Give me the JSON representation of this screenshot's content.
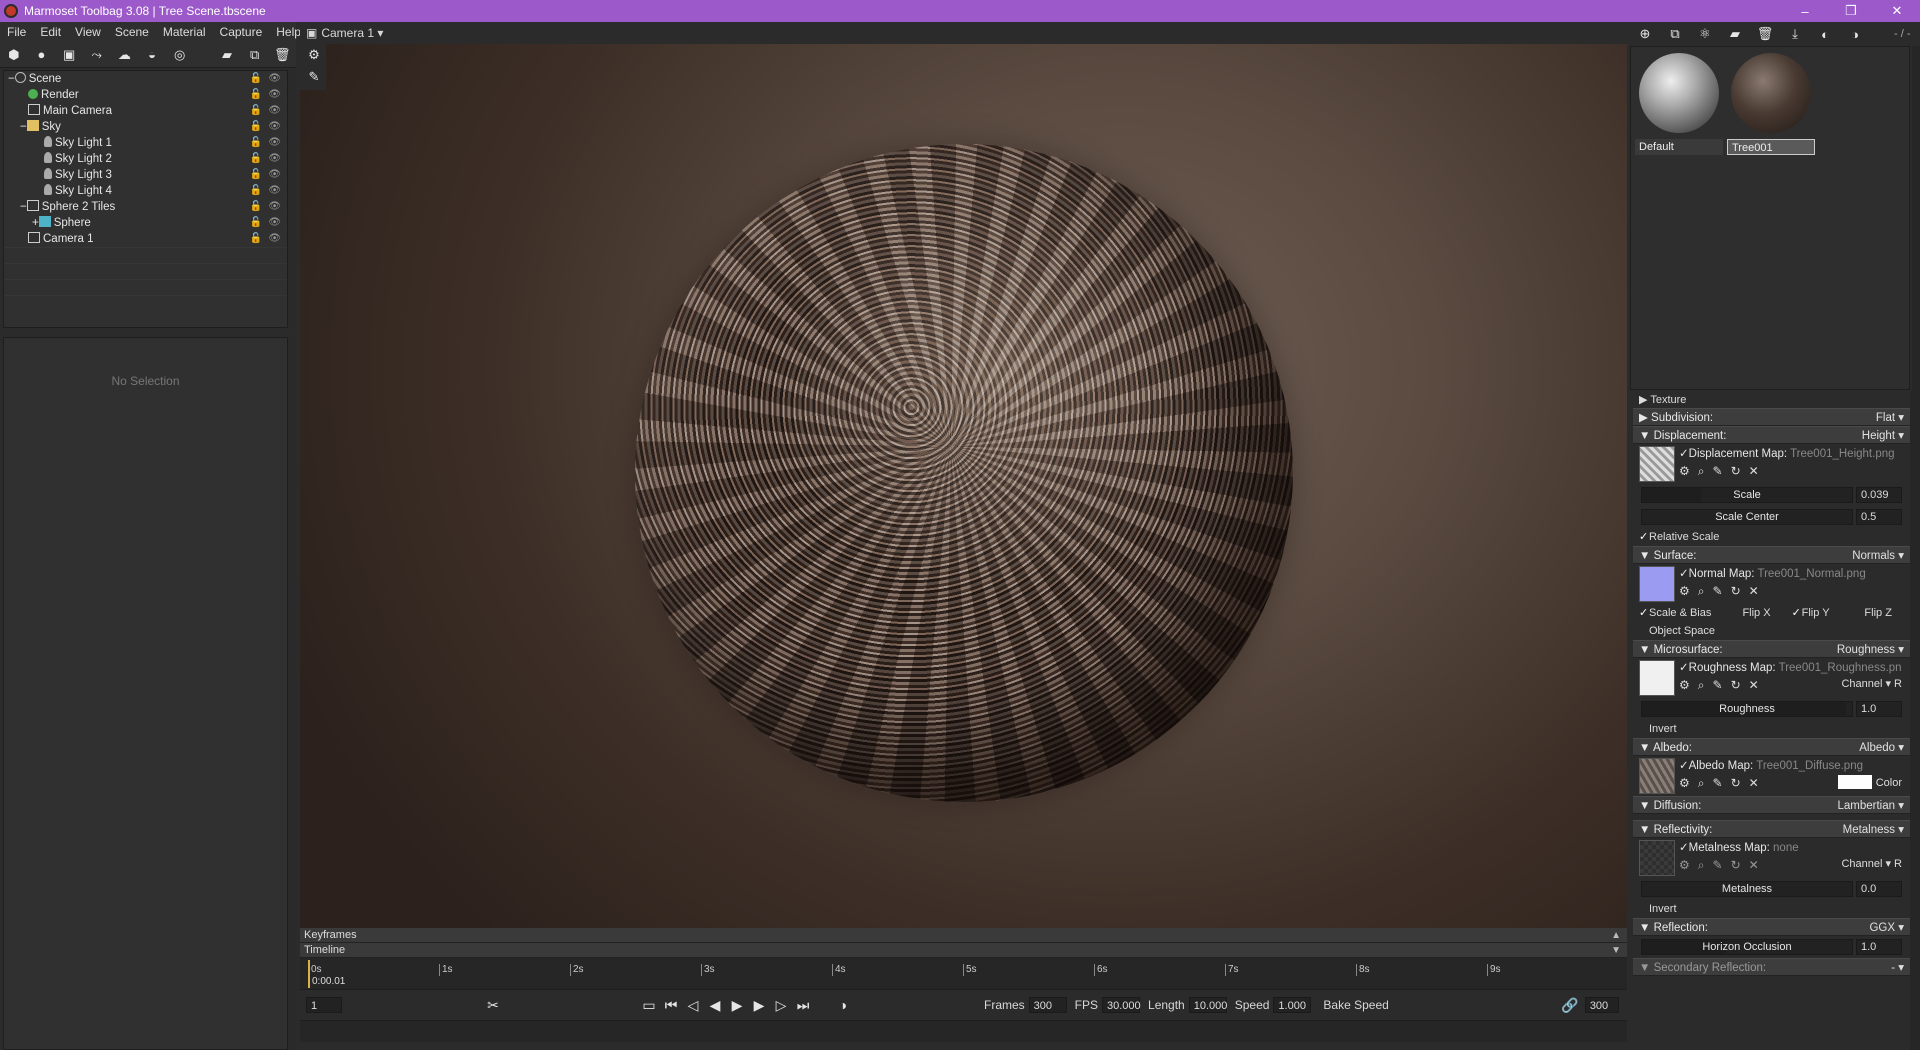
{
  "window": {
    "title": "Marmoset Toolbag 3.08  |  Tree Scene.tbscene",
    "minimize": "–",
    "restore": "❐",
    "close": "✕"
  },
  "menu": [
    "File",
    "Edit",
    "View",
    "Scene",
    "Material",
    "Capture",
    "Help"
  ],
  "scene_tree": [
    {
      "label": "Scene",
      "indent": 0,
      "icon": "scene-icon"
    },
    {
      "label": "Render",
      "indent": 1,
      "icon": "render-icon"
    },
    {
      "label": "Main Camera",
      "indent": 1,
      "icon": "camera-icon"
    },
    {
      "label": "Sky",
      "indent": 1,
      "icon": "sky-icon"
    },
    {
      "label": "Sky Light 1",
      "indent": 2,
      "icon": "light-icon"
    },
    {
      "label": "Sky Light 2",
      "indent": 2,
      "icon": "light-icon"
    },
    {
      "label": "Sky Light 3",
      "indent": 2,
      "icon": "light-icon"
    },
    {
      "label": "Sky Light 4",
      "indent": 2,
      "icon": "light-icon"
    },
    {
      "label": "Sphere 2 Tiles",
      "indent": 1,
      "icon": "object-icon"
    },
    {
      "label": "Sphere",
      "indent": 2,
      "icon": "mesh-icon"
    },
    {
      "label": "Camera 1",
      "indent": 1,
      "icon": "camera-icon"
    }
  ],
  "properties": {
    "empty": "No Selection"
  },
  "viewport": {
    "camera": "Camera 1 ▾"
  },
  "timeline": {
    "keyframes": "Keyframes",
    "timeline": "Timeline",
    "ticks": [
      "0s",
      "1s",
      "2s",
      "3s",
      "4s",
      "5s",
      "6s",
      "7s",
      "8s",
      "9s"
    ],
    "current_time": "0:00.01",
    "frame": "1",
    "frames_label": "Frames",
    "frames": "300",
    "fps_label": "FPS",
    "fps": "30.000",
    "length_label": "Length",
    "length": "10.000",
    "speed_label": "Speed",
    "speed": "1.000",
    "bake_speed": "Bake Speed",
    "end_frame": "300"
  },
  "materials": {
    "items": [
      "Default",
      "Tree001"
    ],
    "counter": "- / -"
  },
  "editor": {
    "texture": "Texture",
    "subdivision": {
      "label": "Subdivision:",
      "value": "Flat"
    },
    "displacement": {
      "label": "Displacement:",
      "value": "Height",
      "map_label": "Displacement Map:",
      "map_file": "Tree001_Height.png",
      "scale_label": "Scale",
      "scale": "0.039",
      "scale_center_label": "Scale Center",
      "scale_center": "0.5",
      "relative": "Relative Scale"
    },
    "surface": {
      "label": "Surface:",
      "value": "Normals",
      "map_label": "Normal Map:",
      "map_file": "Tree001_Normal.png",
      "scale_bias": "Scale & Bias",
      "flip_x": "Flip X",
      "flip_y": "Flip Y",
      "flip_z": "Flip Z",
      "object_space": "Object Space"
    },
    "microsurface": {
      "label": "Microsurface:",
      "value": "Roughness",
      "map_label": "Roughness Map:",
      "map_file": "Tree001_Roughness.pn",
      "channel": "Channel ▾ R",
      "slider_label": "Roughness",
      "slider": "1.0",
      "invert": "Invert"
    },
    "albedo": {
      "label": "Albedo:",
      "value": "Albedo",
      "map_label": "Albedo Map:",
      "map_file": "Tree001_Diffuse.png",
      "color": "Color"
    },
    "diffusion": {
      "label": "Diffusion:",
      "value": "Lambertian"
    },
    "reflectivity": {
      "label": "Reflectivity:",
      "value": "Metalness",
      "map_label": "Metalness Map:",
      "map_file": "none",
      "channel": "Channel ▾ R",
      "slider_label": "Metalness",
      "slider": "0.0",
      "invert": "Invert"
    },
    "reflection": {
      "label": "Reflection:",
      "value": "GGX",
      "occlusion_label": "Horizon Occlusion",
      "occlusion": "1.0"
    },
    "secondary": {
      "label": "Secondary Reflection:",
      "value": "- ▾"
    }
  },
  "colors": {
    "titlebar": "#9b59c9",
    "panel": "#2b2b2b",
    "playhead": "#d8b24a"
  },
  "levels": {
    "scale_fill": 0.28,
    "roughness_fill": 0.97,
    "metalness_fill": 0.0,
    "occlusion_fill": 0.4
  }
}
